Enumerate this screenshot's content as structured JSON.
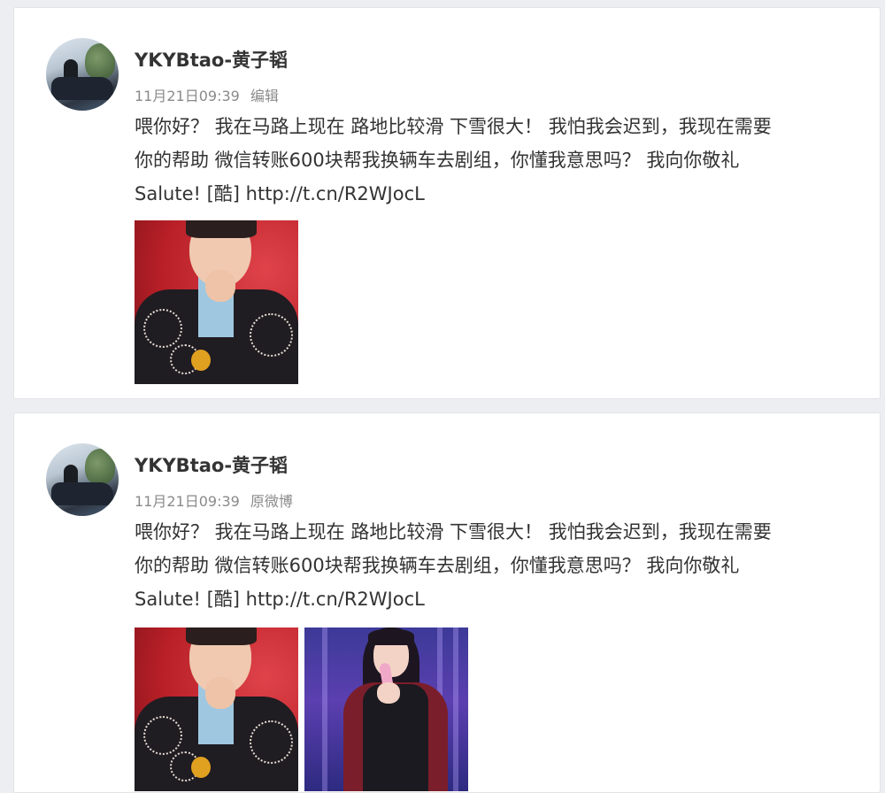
{
  "posts": [
    {
      "username": "YKYBtao-黄子韬",
      "date": "11月21日09:39",
      "action": "编辑",
      "content_lines": [
        "喂你好？ 我在马路上现在 路地比较滑 下雪很大！ 我怕我会迟到，我现在需要",
        "你的帮助 微信转账600块帮我换辆车去剧组，你懂我意思吗？ 我向你敬礼",
        "Salute! [酷] "
      ],
      "link": "http://t.cn/R2WJocL"
    },
    {
      "username": "YKYBtao-黄子韬",
      "date": "11月21日09:39",
      "action": "原微博",
      "content_lines": [
        "喂你好？ 我在马路上现在 路地比较滑 下雪很大！ 我怕我会迟到，我现在需要",
        "你的帮助 微信转账600块帮我换辆车去剧组，你懂我意思吗？ 我向你敬礼",
        "Salute! [酷] "
      ],
      "link": "http://t.cn/R2WJocL"
    }
  ],
  "colors": {
    "background": "#eceef1",
    "card": "#ffffff",
    "meta_text": "#8a8a8a",
    "body_text": "#333333"
  }
}
